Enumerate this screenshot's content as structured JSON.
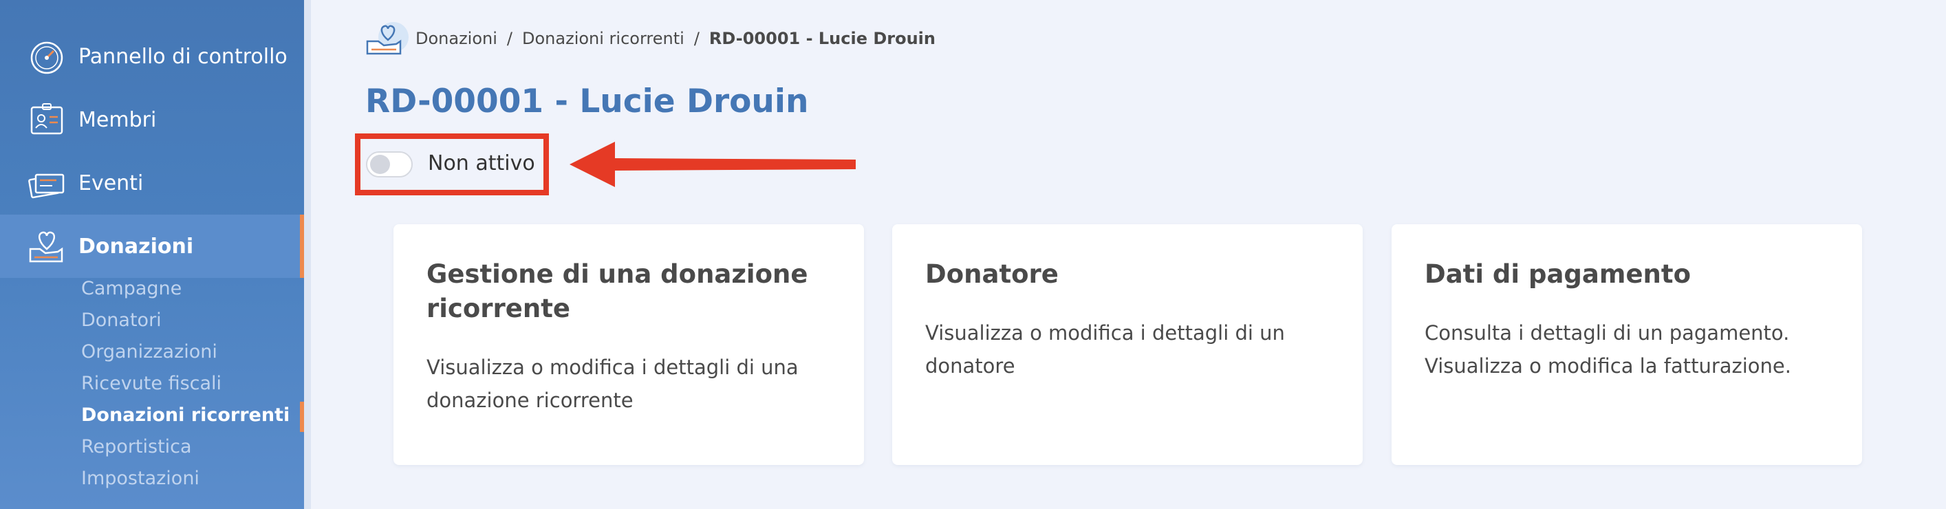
{
  "sidebar": {
    "nav": [
      {
        "label": "Pannello di controllo",
        "icon": "gauge-icon"
      },
      {
        "label": "Membri",
        "icon": "id-card-icon"
      },
      {
        "label": "Eventi",
        "icon": "tickets-icon"
      },
      {
        "label": "Donazioni",
        "icon": "heart-hand-icon",
        "active": true
      }
    ],
    "sub": [
      {
        "label": "Campagne"
      },
      {
        "label": "Donatori"
      },
      {
        "label": "Organizzazioni"
      },
      {
        "label": "Ricevute fiscali"
      },
      {
        "label": "Donazioni ricorrenti",
        "active": true
      },
      {
        "label": "Reportistica"
      },
      {
        "label": "Impostazioni"
      }
    ]
  },
  "breadcrumb": {
    "icon": "heart-hand-icon",
    "items": [
      "Donazioni",
      "Donazioni ricorrenti",
      "RD-00001 - Lucie Drouin"
    ],
    "separator": "/"
  },
  "page": {
    "title": "RD-00001 - Lucie Drouin",
    "toggle": {
      "label": "Non attivo",
      "checked": false
    }
  },
  "cards": [
    {
      "title": "Gestione di una donazione ricorrente",
      "desc": "Visualizza o modifica i dettagli di una donazione ricorrente"
    },
    {
      "title": "Donatore",
      "desc": "Visualizza o modifica i dettagli di un donatore"
    },
    {
      "title": "Dati di pagamento",
      "desc": "Consulta i dettagli di un pagamento. Visualizza o modifica la fatturazione."
    }
  ],
  "colors": {
    "sidebar": "#4a80bf",
    "accent": "#ee8a4e",
    "title": "#4577b5",
    "highlight": "#e53a25",
    "background": "#f0f3fb"
  }
}
